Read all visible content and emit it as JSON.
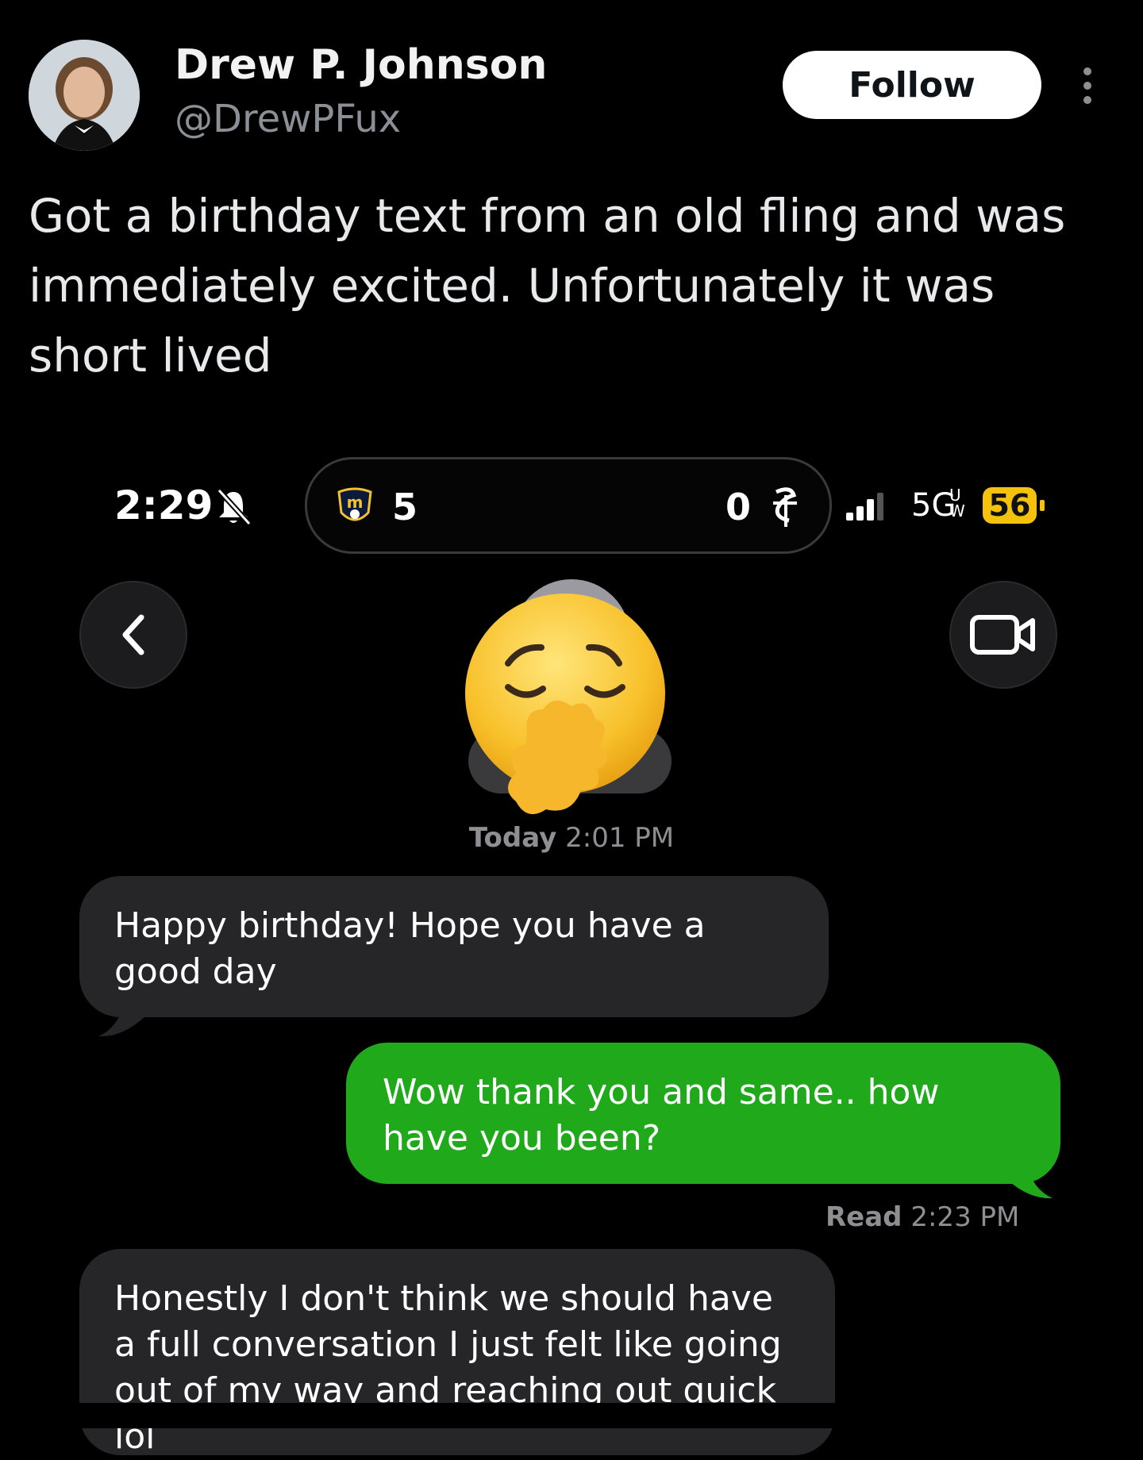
{
  "tweet": {
    "author_name": "Drew P. Johnson",
    "author_handle": "@DrewPFux",
    "follow_label": "Follow",
    "text": "Got a birthday text from an old fling and was immediately excited. Unfortunately it was short lived"
  },
  "status_bar": {
    "time": "2:29",
    "home_score": "5",
    "away_score": "0",
    "network": "5G",
    "network_suffix_top": "U",
    "network_suffix_bottom": "W",
    "battery": "56"
  },
  "conversation": {
    "timestamp_day": "Today",
    "timestamp_time": "2:01 PM",
    "messages": [
      {
        "direction": "incoming",
        "text": "Happy birthday! Hope you have a good day"
      },
      {
        "direction": "outgoing",
        "text": "Wow thank you and same.. how have you been?"
      },
      {
        "direction": "incoming",
        "text": "Honestly I don't think we should have a full conversation I just felt like going out of my way and reaching out quick lol"
      }
    ],
    "read_label": "Read",
    "read_time": "2:23 PM"
  },
  "colors": {
    "background": "#000000",
    "incoming_bubble": "#262628",
    "outgoing_bubble": "#1fa91b",
    "battery": "#f4c20d",
    "secondary_text": "#8e8e93"
  },
  "icons": [
    "avatar",
    "more-icon",
    "mute-icon",
    "brewers-logo",
    "cardinals-logo",
    "signal-icon",
    "back-chevron-icon",
    "video-call-icon",
    "pensive-face-emoji-sticker",
    "hand-emoji-sticker"
  ]
}
